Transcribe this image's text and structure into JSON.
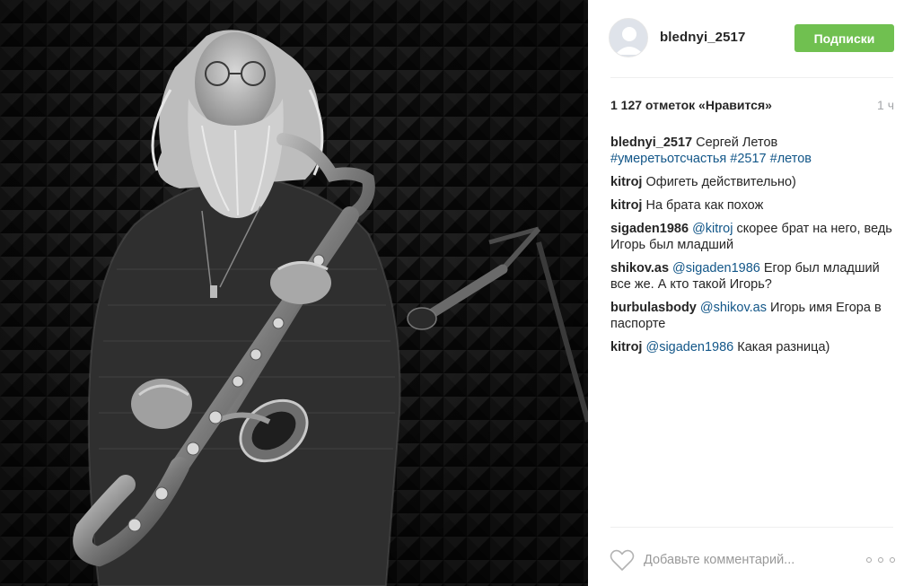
{
  "post": {
    "photo_icon": "photo-saxophonist",
    "username": "blednyi_2517",
    "follow_label": "Подписки",
    "likes": "1 127 отметок «Нравится»",
    "time": "1 ч",
    "caption": {
      "user": "blednyi_2517",
      "text": " Сергей Летов ",
      "tags": "#умеретьотсчастья #2517 #летов"
    },
    "comments": [
      {
        "user": "kitroj",
        "mention": "",
        "text": " Офигеть действительно)"
      },
      {
        "user": "kitroj",
        "mention": "",
        "text": " На брата как похож"
      },
      {
        "user": "sigaden1986",
        "mention": " @kitroj",
        "text": " скорее брат на него, ведь Игорь был младший"
      },
      {
        "user": "shikov.as",
        "mention": " @sigaden1986",
        "text": " Егор был младший все же. А кто такой Игорь?"
      },
      {
        "user": "burbulasbody",
        "mention": " @shikov.as",
        "text": " Игорь имя Егора в паспорте"
      },
      {
        "user": "kitroj",
        "mention": " @sigaden1986",
        "text": " Какая разница)"
      }
    ],
    "add_comment_placeholder": "Добавьте комментарий...",
    "like_icon": "heart-outline-icon",
    "more_icon": "more-dots-icon"
  },
  "colors": {
    "follow_button": "#70c050",
    "link": "#125688",
    "muted": "#a5a7aa"
  }
}
